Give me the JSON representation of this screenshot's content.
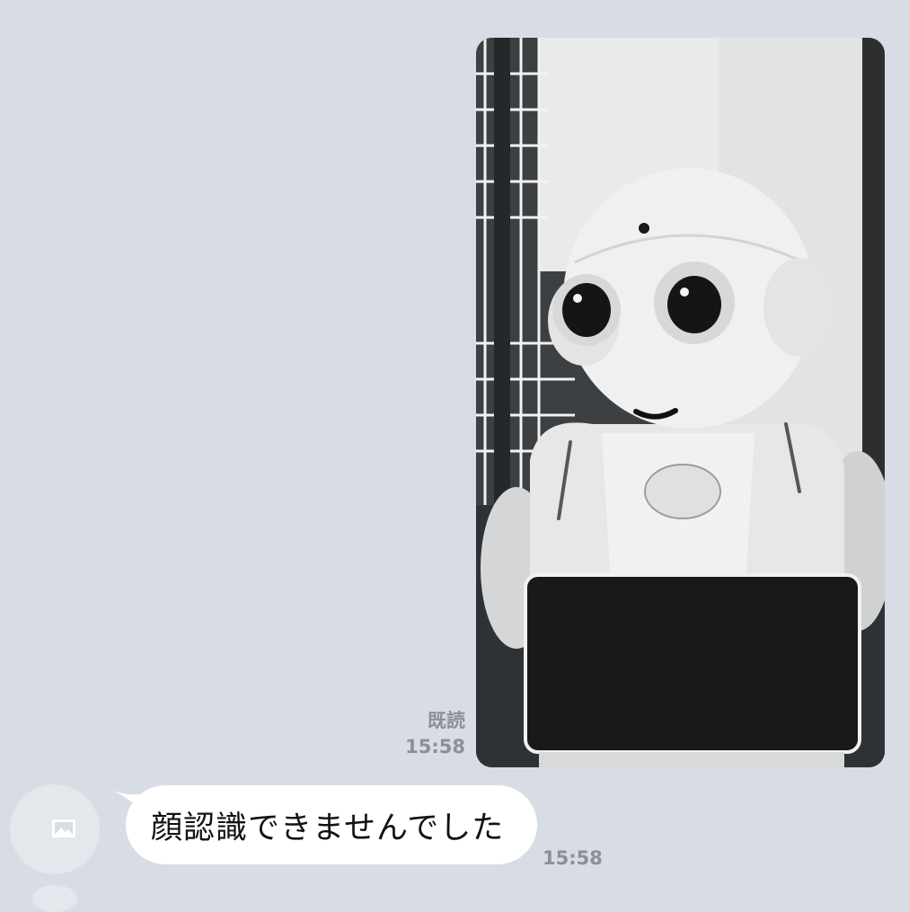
{
  "outgoing_message": {
    "type": "image",
    "read_status": "既読",
    "time": "15:58"
  },
  "incoming_message": {
    "text": "顔認識できませんでした",
    "time": "15:58"
  },
  "icons": {
    "avatar": "image-placeholder-icon"
  }
}
